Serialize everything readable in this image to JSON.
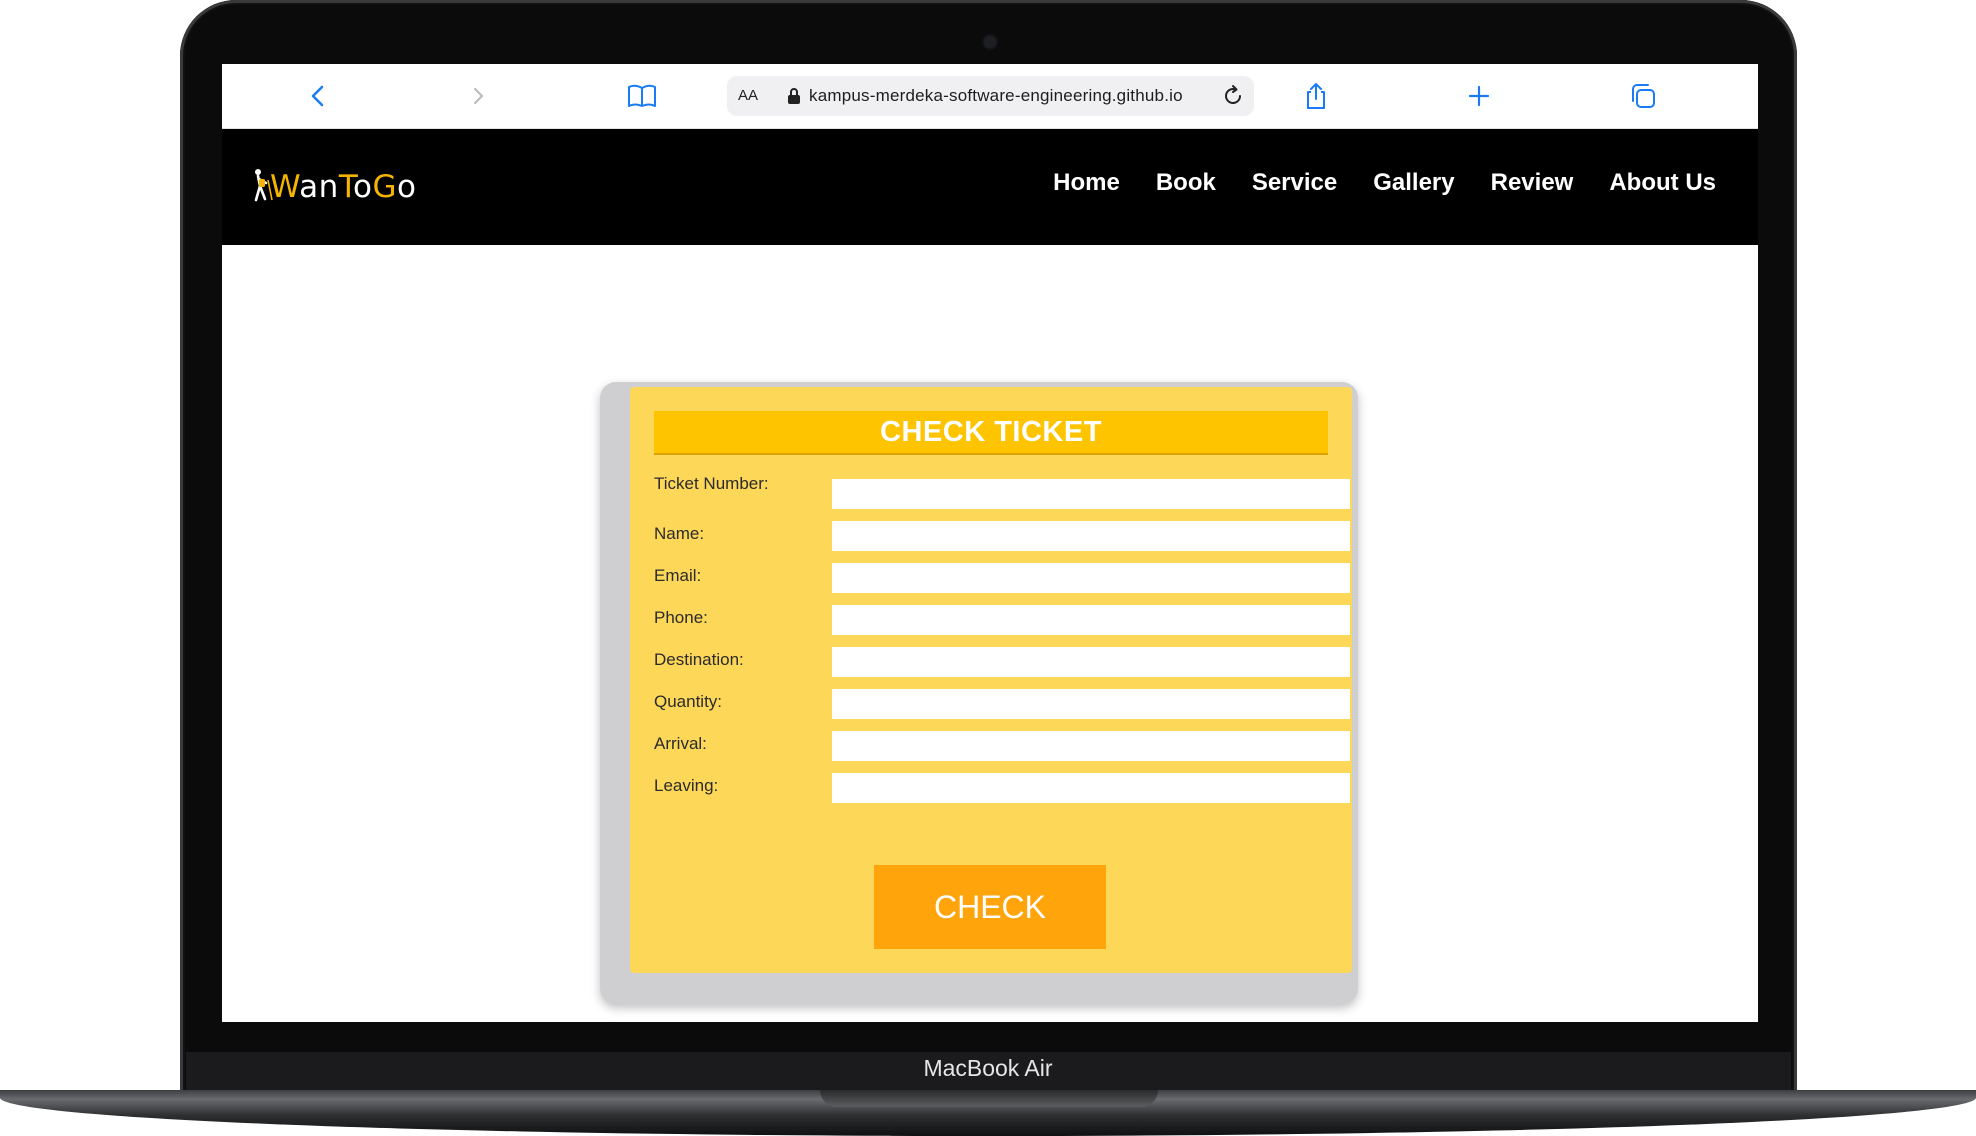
{
  "device": {
    "label": "MacBook Air"
  },
  "browser": {
    "text_size_label": "AA",
    "url": "kampus-merdeka-software-engineering.github.io",
    "buttons": {
      "back": "back-icon",
      "forward": "forward-icon",
      "bookmarks": "book-icon",
      "reload": "reload-icon",
      "share": "share-icon",
      "new_tab": "plus-icon",
      "tabs": "tabs-icon"
    }
  },
  "site": {
    "logo": {
      "part1": "W",
      "part2": "an",
      "part3": "T",
      "part4": "o",
      "part5": "G",
      "part6": "o"
    },
    "nav": [
      "Home",
      "Book",
      "Service",
      "Gallery",
      "Review",
      "About Us"
    ]
  },
  "form": {
    "title": "CHECK TICKET",
    "fields": [
      {
        "label": "Ticket Number:",
        "value": ""
      },
      {
        "label": "Name:",
        "value": ""
      },
      {
        "label": "Email:",
        "value": ""
      },
      {
        "label": "Phone:",
        "value": ""
      },
      {
        "label": "Destination:",
        "value": ""
      },
      {
        "label": "Quantity:",
        "value": ""
      },
      {
        "label": "Arrival:",
        "value": ""
      },
      {
        "label": "Leaving:",
        "value": ""
      }
    ],
    "submit_label": "CHECK"
  },
  "colors": {
    "card": "#fdd757",
    "title_bar": "#ffc400",
    "button": "#ffa40b",
    "nav_bg": "#000000",
    "logo_accent": "#f5b400"
  }
}
